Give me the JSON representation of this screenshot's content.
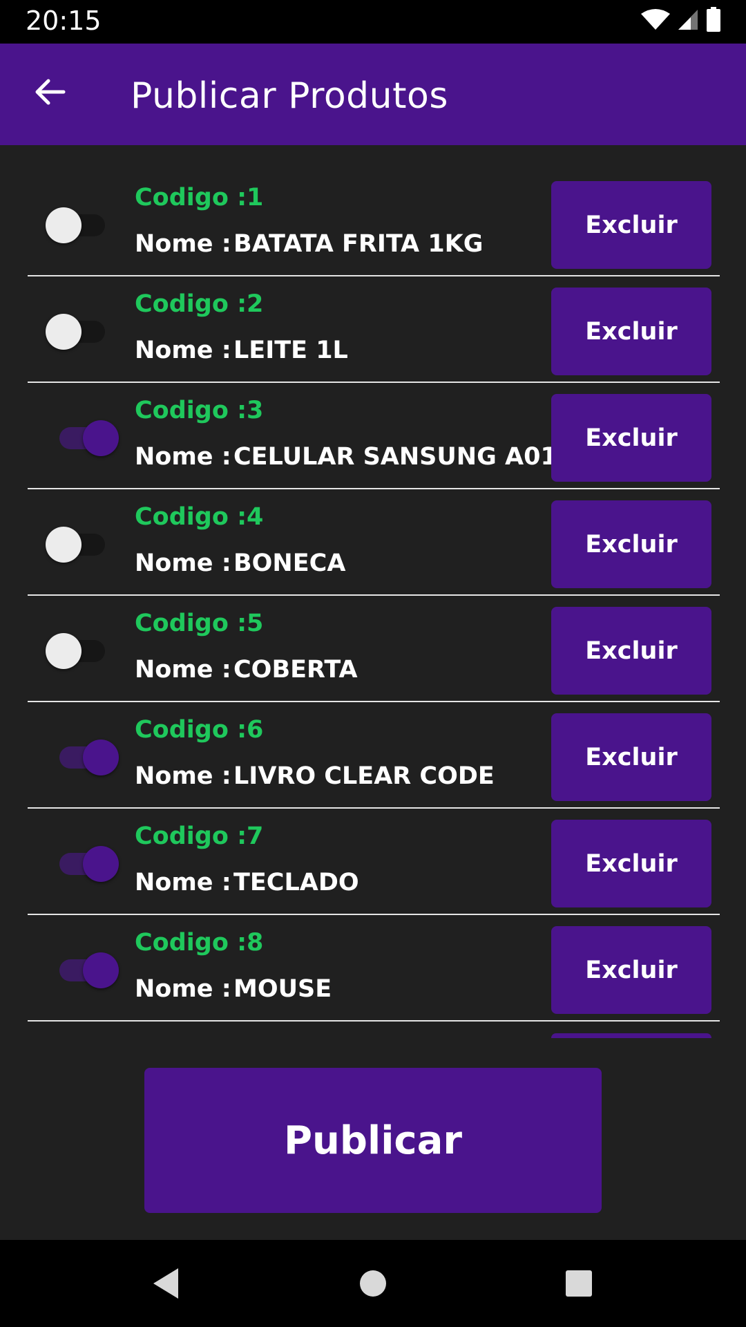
{
  "status_bar": {
    "time": "20:15"
  },
  "app_bar": {
    "title": "Publicar Produtos"
  },
  "labels": {
    "code": "Codigo :",
    "name": "Nome :"
  },
  "products": [
    {
      "code": "1",
      "name": "BATATA FRITA 1KG",
      "selected": false,
      "delete_label": "Excluir"
    },
    {
      "code": "2",
      "name": "LEITE 1L",
      "selected": false,
      "delete_label": "Excluir"
    },
    {
      "code": "3",
      "name": "CELULAR SANSUNG A01",
      "selected": true,
      "delete_label": "Excluir"
    },
    {
      "code": "4",
      "name": "BONECA",
      "selected": false,
      "delete_label": "Excluir"
    },
    {
      "code": "5",
      "name": "COBERTA",
      "selected": false,
      "delete_label": "Excluir"
    },
    {
      "code": "6",
      "name": "LIVRO CLEAR CODE",
      "selected": true,
      "delete_label": "Excluir"
    },
    {
      "code": "7",
      "name": "TECLADO",
      "selected": true,
      "delete_label": "Excluir"
    },
    {
      "code": "8",
      "name": "MOUSE",
      "selected": true,
      "delete_label": "Excluir"
    }
  ],
  "publish_button": {
    "label": "Publicar"
  },
  "colors": {
    "primary": "#4a148c",
    "code_green": "#1fc85c",
    "background": "#202020"
  },
  "icons": [
    "arrow-back-icon",
    "wifi-icon",
    "cell-signal-icon",
    "battery-icon",
    "nav-back-icon",
    "nav-home-icon",
    "nav-recents-icon"
  ]
}
